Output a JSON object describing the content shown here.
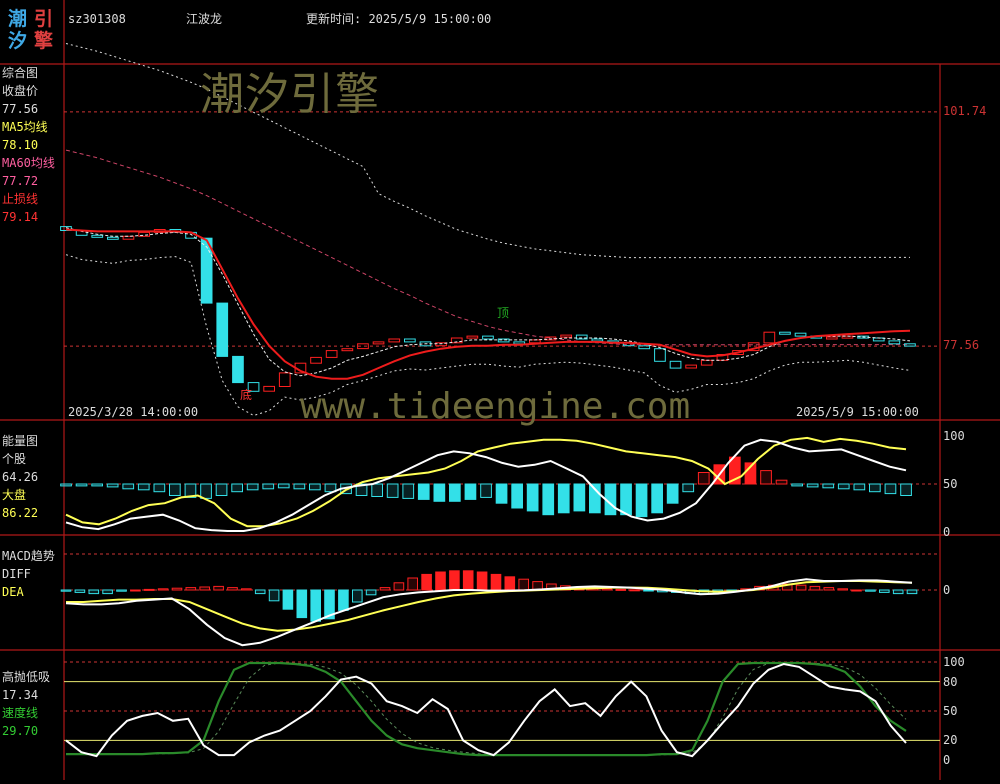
{
  "header": {
    "code": "sz301308",
    "name": "江波龙",
    "update_label": "更新时间: 2025/5/9 15:00:00",
    "logo_chars": [
      "潮",
      "引",
      "汐",
      "擎"
    ]
  },
  "watermarks": {
    "brand": "潮汐引擎",
    "url": "www.tideengine.com"
  },
  "panels": {
    "main": {
      "legend": [
        {
          "label": "综合图",
          "color": "#dddddd"
        },
        {
          "label": "收盘价",
          "color": "#dddddd"
        },
        {
          "label": "77.56",
          "color": "#dddddd"
        },
        {
          "label": "MA5均线",
          "color": "#ffff55"
        },
        {
          "label": "78.10",
          "color": "#ffff55"
        },
        {
          "label": "MA60均线",
          "color": "#ff5fa0"
        },
        {
          "label": "77.72",
          "color": "#ff5fa0"
        },
        {
          "label": "止损线",
          "color": "#ff3333"
        },
        {
          "label": "79.14",
          "color": "#ff3333"
        }
      ],
      "right_labels": [
        "101.74",
        "77.56"
      ],
      "date_start": "2025/3/28 14:00:00",
      "date_end": "2025/5/9 15:00:00",
      "mark_bottom": "底",
      "mark_top": "顶"
    },
    "energy": {
      "legend": [
        {
          "label": "能量图",
          "color": "#dddddd"
        },
        {
          "label": "个股",
          "color": "#dddddd"
        },
        {
          "label": "64.26",
          "color": "#dddddd"
        },
        {
          "label": "大盘",
          "color": "#ffff55"
        },
        {
          "label": "86.22",
          "color": "#ffff55"
        }
      ],
      "right_labels": [
        "100",
        "50",
        "0"
      ]
    },
    "macd": {
      "legend": [
        {
          "label": "MACD趋势",
          "color": "#dddddd"
        },
        {
          "label": "DIFF",
          "color": "#dddddd"
        },
        {
          "label": "DEA",
          "color": "#ffff55"
        }
      ],
      "right_labels": [
        "0"
      ]
    },
    "kdj": {
      "legend": [
        {
          "label": "高抛低吸",
          "color": "#dddddd"
        },
        {
          "label": "17.34",
          "color": "#dddddd"
        },
        {
          "label": "速度线",
          "color": "#33cc33"
        },
        {
          "label": "29.70",
          "color": "#33cc33"
        }
      ],
      "right_labels": [
        "100",
        "80",
        "50",
        "20",
        "0"
      ]
    }
  },
  "colors": {
    "frame": "#b01818",
    "up": "#ff2020",
    "down": "#33e0e8",
    "ma5": "#ffff55",
    "ma60": "#cc4466",
    "stop": "#ee1c1c",
    "white": "#ffffff",
    "green": "#2a8a2a",
    "label_red": "#cc3333"
  },
  "chart_data": [
    {
      "type": "line",
      "title": "综合图",
      "x_range": [
        "2025/3/28 14:00:00",
        "2025/5/9 15:00:00"
      ],
      "ylim": [
        72,
        104
      ],
      "right_ticks": [
        101.74,
        77.56
      ],
      "series": [
        {
          "name": "收盘价",
          "values": [
            89.5,
            89.0,
            88.8,
            88.6,
            88.9,
            89.3,
            89.6,
            89.3,
            88.7,
            82.0,
            76.5,
            73.8,
            72.9,
            73.4,
            74.8,
            75.8,
            76.4,
            77.1,
            77.3,
            77.8,
            78.0,
            78.3,
            78.0,
            77.6,
            77.9,
            78.4,
            78.6,
            78.3,
            78.0,
            77.9,
            78.2,
            78.5,
            78.7,
            78.3,
            78.1,
            77.9,
            77.6,
            77.3,
            76.0,
            75.3,
            75.6,
            76.1,
            76.7,
            77.1,
            77.9,
            79.0,
            78.9,
            78.6,
            78.4,
            78.5,
            78.6,
            78.4,
            78.1,
            77.8,
            77.56
          ],
          "color": "#33e0e8"
        },
        {
          "name": "MA5均线",
          "values": [
            89.8,
            89.4,
            89.1,
            88.9,
            88.9,
            89.0,
            89.2,
            89.3,
            89.1,
            87.8,
            85.0,
            81.9,
            78.8,
            76.2,
            74.9,
            74.5,
            74.8,
            75.3,
            76.1,
            76.5,
            77.0,
            77.5,
            77.7,
            77.8,
            77.8,
            78.0,
            78.2,
            78.2,
            78.2,
            78.2,
            78.2,
            78.3,
            78.4,
            78.4,
            78.4,
            78.3,
            78.1,
            77.8,
            77.4,
            76.8,
            76.3,
            76.1,
            76.1,
            76.3,
            76.7,
            77.5,
            78.1,
            78.4,
            78.6,
            78.6,
            78.6,
            78.5,
            78.4,
            78.3,
            78.1
          ],
          "color": "#ffff55"
        },
        {
          "name": "MA60均线",
          "values": [
            97.8,
            97.4,
            97.0,
            96.5,
            96.0,
            95.5,
            95.0,
            94.4,
            93.8,
            93.1,
            92.3,
            91.5,
            90.7,
            89.9,
            89.1,
            88.3,
            87.5,
            86.7,
            85.9,
            85.1,
            84.3,
            83.5,
            82.8,
            82.0,
            81.3,
            80.6,
            80.1,
            79.6,
            79.2,
            78.9,
            78.6,
            78.4,
            78.2,
            78.0,
            77.9,
            77.8,
            77.7,
            77.7,
            77.7,
            77.7,
            77.7,
            77.7,
            77.7,
            77.7,
            77.7,
            77.72,
            77.72,
            77.72,
            77.72,
            77.72,
            77.72,
            77.72,
            77.72,
            77.72,
            77.72
          ],
          "color": "#cc4466"
        },
        {
          "name": "止损线",
          "values": [
            89.6,
            89.5,
            89.4,
            89.4,
            89.4,
            89.4,
            89.4,
            89.4,
            89.3,
            88.5,
            85.5,
            82.5,
            79.8,
            77.6,
            76.0,
            75.0,
            74.4,
            74.2,
            74.2,
            74.6,
            75.3,
            76.0,
            76.6,
            77.0,
            77.3,
            77.5,
            77.6,
            77.6,
            77.7,
            77.7,
            77.8,
            77.9,
            78.0,
            78.0,
            78.0,
            77.9,
            77.9,
            77.8,
            77.7,
            77.2,
            76.7,
            76.5,
            76.6,
            76.9,
            77.3,
            77.7,
            78.1,
            78.4,
            78.6,
            78.7,
            78.8,
            78.9,
            79.0,
            79.1,
            79.14
          ],
          "color": "#ee1c1c"
        }
      ]
    },
    {
      "type": "bar",
      "title": "能量图",
      "ylim": [
        0,
        100
      ],
      "right_ticks": [
        100,
        50,
        0
      ],
      "series": [
        {
          "name": "个股",
          "values": [
            10,
            5,
            3,
            8,
            14,
            16,
            18,
            12,
            4,
            2,
            1,
            1,
            4,
            10,
            18,
            28,
            38,
            45,
            48,
            50,
            56,
            64,
            72,
            80,
            84,
            82,
            78,
            72,
            68,
            70,
            74,
            66,
            58,
            40,
            25,
            16,
            12,
            14,
            20,
            30,
            50,
            72,
            90,
            96,
            94,
            88,
            84,
            85,
            86,
            80,
            74,
            68,
            64.26
          ],
          "color": "#ffffff"
        },
        {
          "name": "大盘",
          "values": [
            18,
            10,
            8,
            14,
            22,
            28,
            30,
            36,
            38,
            30,
            14,
            6,
            6,
            9,
            14,
            22,
            32,
            44,
            52,
            56,
            58,
            60,
            62,
            66,
            74,
            84,
            88,
            92,
            94,
            96,
            96,
            95,
            92,
            88,
            84,
            82,
            80,
            78,
            74,
            66,
            50,
            58,
            76,
            90,
            96,
            98,
            94,
            97,
            95,
            92,
            88,
            86.22
          ],
          "color": "#ffff55"
        },
        {
          "name": "柱",
          "values": [
            -2,
            -2,
            -2,
            -3,
            -5,
            -6,
            -8,
            -12,
            -14,
            -15,
            -12,
            -8,
            -6,
            -5,
            -4,
            -5,
            -6,
            -8,
            -10,
            -12,
            -13,
            -14,
            -15,
            -16,
            -18,
            -18,
            -16,
            -14,
            -20,
            -25,
            -28,
            -32,
            -30,
            -28,
            -30,
            -32,
            -32,
            -34,
            -30,
            -20,
            -8,
            12,
            20,
            28,
            22,
            14,
            4,
            -2,
            -3,
            -4,
            -5,
            -6,
            -8,
            -10,
            -12
          ]
        }
      ]
    },
    {
      "type": "bar",
      "title": "MACD趋势",
      "ylim": [
        -5,
        2.5
      ],
      "right_ticks": [
        0
      ],
      "series": [
        {
          "name": "DIFF",
          "values": [
            -1.1,
            -1.2,
            -1.2,
            -1.1,
            -0.9,
            -0.8,
            -0.7,
            -1.6,
            -2.9,
            -4.0,
            -4.6,
            -4.4,
            -3.9,
            -3.3,
            -2.7,
            -2.1,
            -1.6,
            -1.1,
            -0.6,
            -0.35,
            -0.2,
            -0.1,
            0,
            0,
            -0.05,
            -0.05,
            -0.02,
            0.05,
            0.15,
            0.25,
            0.3,
            0.25,
            0.2,
            0.1,
            0,
            -0.2,
            -0.35,
            -0.3,
            -0.15,
            0.05,
            0.3,
            0.7,
            0.9,
            0.75,
            0.75,
            0.8,
            0.8,
            0.7,
            0.6
          ],
          "color": "#ffffff"
        },
        {
          "name": "DEA",
          "values": [
            -1.0,
            -1.0,
            -0.9,
            -0.8,
            -0.8,
            -0.75,
            -0.75,
            -1.0,
            -1.6,
            -2.2,
            -2.8,
            -3.2,
            -3.4,
            -3.3,
            -3.1,
            -2.8,
            -2.5,
            -2.1,
            -1.7,
            -1.35,
            -1.0,
            -0.7,
            -0.45,
            -0.3,
            -0.2,
            -0.1,
            -0.05,
            0,
            0.05,
            0.1,
            0.15,
            0.2,
            0.2,
            0.18,
            0.1,
            0,
            -0.1,
            -0.15,
            -0.1,
            0,
            0.2,
            0.45,
            0.65,
            0.7,
            0.75,
            0.75,
            0.7,
            0.65,
            0.6
          ],
          "color": "#ffff55"
        },
        {
          "name": "MACD柱",
          "values": [
            -0.1,
            -0.2,
            -0.3,
            -0.3,
            -0.1,
            0,
            0.05,
            0.1,
            0.15,
            0.2,
            0.25,
            0.3,
            0.2,
            0.1,
            -0.3,
            -0.9,
            -1.6,
            -2.3,
            -2.6,
            -2.4,
            -1.7,
            -1.0,
            -0.4,
            0.2,
            0.6,
            1.0,
            1.3,
            1.5,
            1.6,
            1.6,
            1.5,
            1.3,
            1.1,
            0.9,
            0.7,
            0.5,
            0.35,
            0.2,
            0.15,
            0.1,
            0.05,
            0.02,
            -0.05,
            -0.15,
            -0.2,
            -0.3,
            -0.3,
            -0.2,
            -0.1,
            0.1,
            0.3,
            0.4,
            0.5,
            0.4,
            0.3,
            0.2,
            0.1,
            0,
            -0.1,
            -0.2,
            -0.3,
            -0.3
          ]
        }
      ]
    },
    {
      "type": "line",
      "title": "高抛低吸",
      "ylim": [
        0,
        100
      ],
      "right_ticks": [
        100,
        80,
        50,
        20,
        0
      ],
      "series": [
        {
          "name": "高抛低吸",
          "values": [
            20,
            8,
            4,
            25,
            40,
            45,
            48,
            40,
            42,
            15,
            5,
            5,
            18,
            25,
            30,
            40,
            50,
            65,
            82,
            85,
            78,
            60,
            55,
            48,
            62,
            52,
            20,
            10,
            5,
            18,
            40,
            60,
            72,
            55,
            58,
            45,
            65,
            80,
            65,
            30,
            8,
            4,
            20,
            38,
            55,
            78,
            92,
            98,
            95,
            85,
            75,
            72,
            70,
            60,
            35,
            17.34
          ],
          "color": "#ffffff"
        },
        {
          "name": "速度线",
          "values": [
            6,
            6,
            6,
            6,
            6,
            6,
            7,
            7,
            8,
            20,
            60,
            92,
            99,
            99,
            99,
            98,
            96,
            90,
            80,
            60,
            40,
            25,
            16,
            12,
            10,
            8,
            6,
            5,
            5,
            5,
            5,
            5,
            5,
            5,
            5,
            5,
            5,
            5,
            5,
            6,
            6,
            10,
            40,
            80,
            98,
            99,
            99,
            99,
            99,
            98,
            96,
            90,
            75,
            55,
            40,
            29.7
          ],
          "color": "#33cc33"
        }
      ]
    }
  ]
}
